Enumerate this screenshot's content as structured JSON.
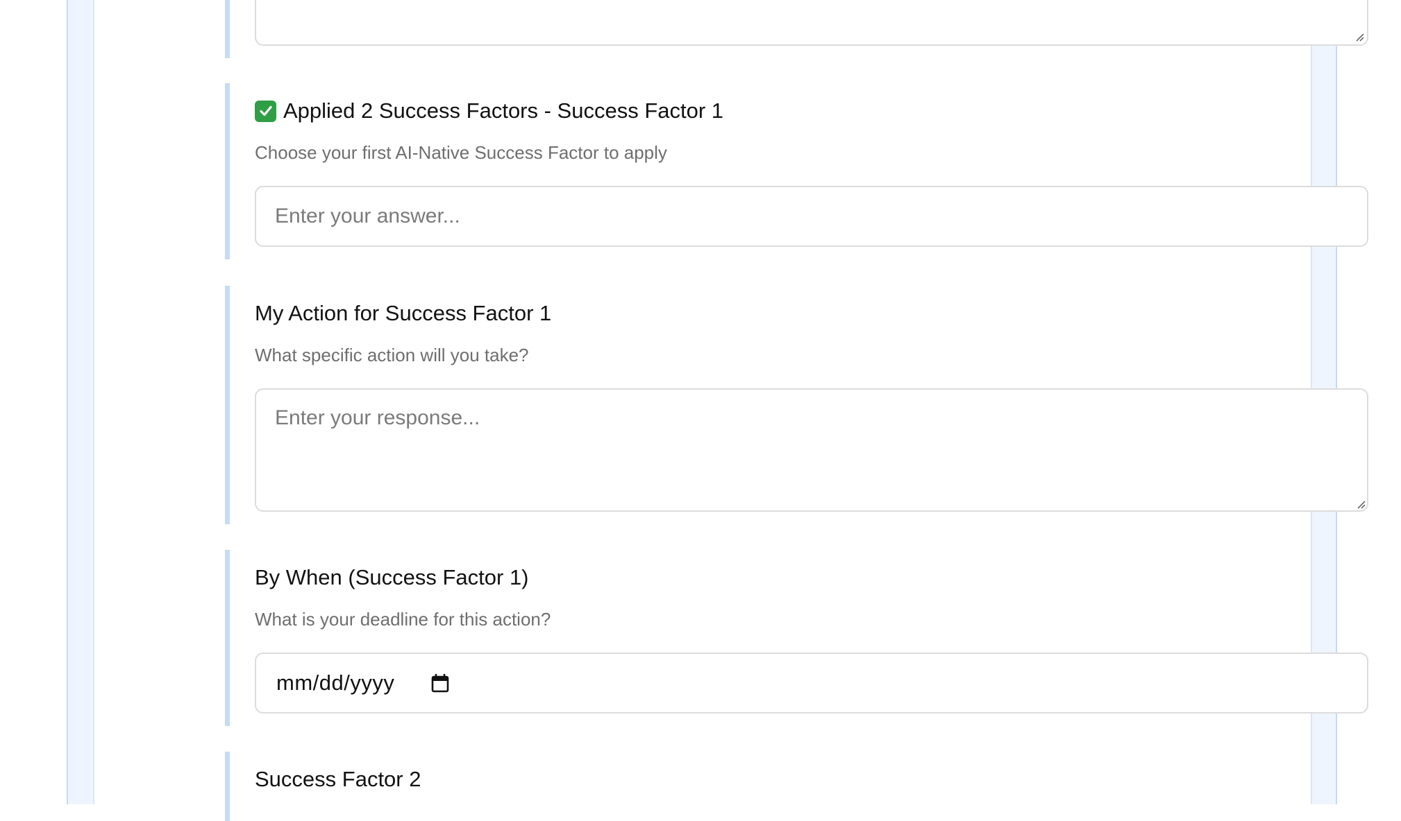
{
  "questions": [
    {
      "id": "previous-response",
      "title": "",
      "description": "",
      "field_type": "textarea",
      "placeholder": ""
    },
    {
      "id": "success-factor-1",
      "title": "Applied 2 Success Factors - Success Factor 1",
      "title_icon": "check-mark-button-icon",
      "description": "Choose your first AI-Native Success Factor to apply",
      "field_type": "text",
      "placeholder": "Enter your answer..."
    },
    {
      "id": "action-success-factor-1",
      "title": "My Action for Success Factor 1",
      "description": "What specific action will you take?",
      "field_type": "textarea",
      "placeholder": "Enter your response..."
    },
    {
      "id": "by-when-success-factor-1",
      "title": "By When (Success Factor 1)",
      "description": "What is your deadline for this action?",
      "field_type": "date",
      "date_format": "mm/dd/yyyy",
      "date_icon": "calendar-icon"
    },
    {
      "id": "success-factor-2",
      "title": "Success Factor 2"
    }
  ],
  "colors": {
    "accent_bar": "#c6dbf7",
    "page_background": "#eef5fe",
    "check_icon": "#2f9e44",
    "description_text": "#6e6e6e",
    "field_border": "#dcdcdc"
  }
}
